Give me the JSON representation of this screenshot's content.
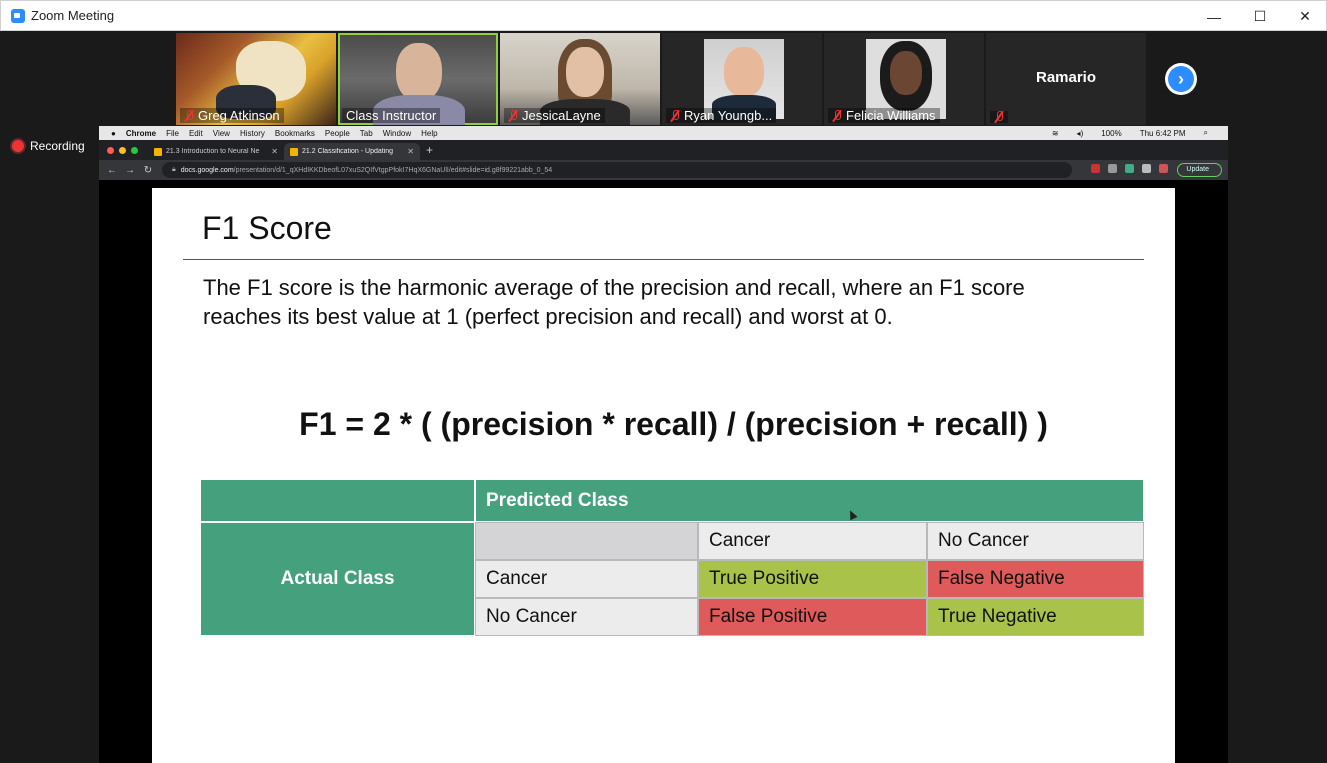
{
  "window": {
    "title": "Zoom Meeting",
    "controls": [
      "—",
      "☐",
      "✕"
    ]
  },
  "participants": [
    {
      "name": "Greg Atkinson",
      "muted": true
    },
    {
      "name": "Class Instructor",
      "muted": false,
      "active": true
    },
    {
      "name": "JessicaLayne",
      "muted": true
    },
    {
      "name": "Ryan Youngb...",
      "muted": true
    },
    {
      "name": "Felicia Williams",
      "muted": true
    },
    {
      "name": "Ramario",
      "muted": true
    }
  ],
  "next_label": "›",
  "recording": {
    "label": "Recording"
  },
  "mac": {
    "menu": [
      "Chrome",
      "File",
      "Edit",
      "View",
      "History",
      "Bookmarks",
      "People",
      "Tab",
      "Window",
      "Help"
    ],
    "battery": "100%",
    "clock": "Thu 6:42 PM"
  },
  "browser": {
    "tabs": [
      {
        "label": "21.3 Introduction to Neural Ne",
        "active": false
      },
      {
        "label": "21.2 Classification - Updating",
        "active": true
      }
    ],
    "url_domain": "docs.google.com",
    "url_path": "/presentation/d/1_qXHdIKKDbeofL07xuS2QIfVtgpPfokI7HqX6GNaUlI/edit#slide=id.g8f99221abb_0_54",
    "update_label": "Update"
  },
  "slide": {
    "title": "F1 Score",
    "body": "The F1 score is the harmonic average of the precision and recall, where an F1 score reaches its best value at 1 (perfect precision and recall) and worst at 0.",
    "formula": "F1 = 2 * ( (precision * recall) / (precision + recall) )",
    "matrix": {
      "predicted_header": "Predicted Class",
      "actual_header": "Actual Class",
      "col_cancer": "Cancer",
      "col_no_cancer": "No Cancer",
      "row_cancer": "Cancer",
      "row_no_cancer": "No Cancer",
      "tp": "True Positive",
      "fn": "False Negative",
      "fp": "False Positive",
      "tn": "True Negative"
    }
  }
}
